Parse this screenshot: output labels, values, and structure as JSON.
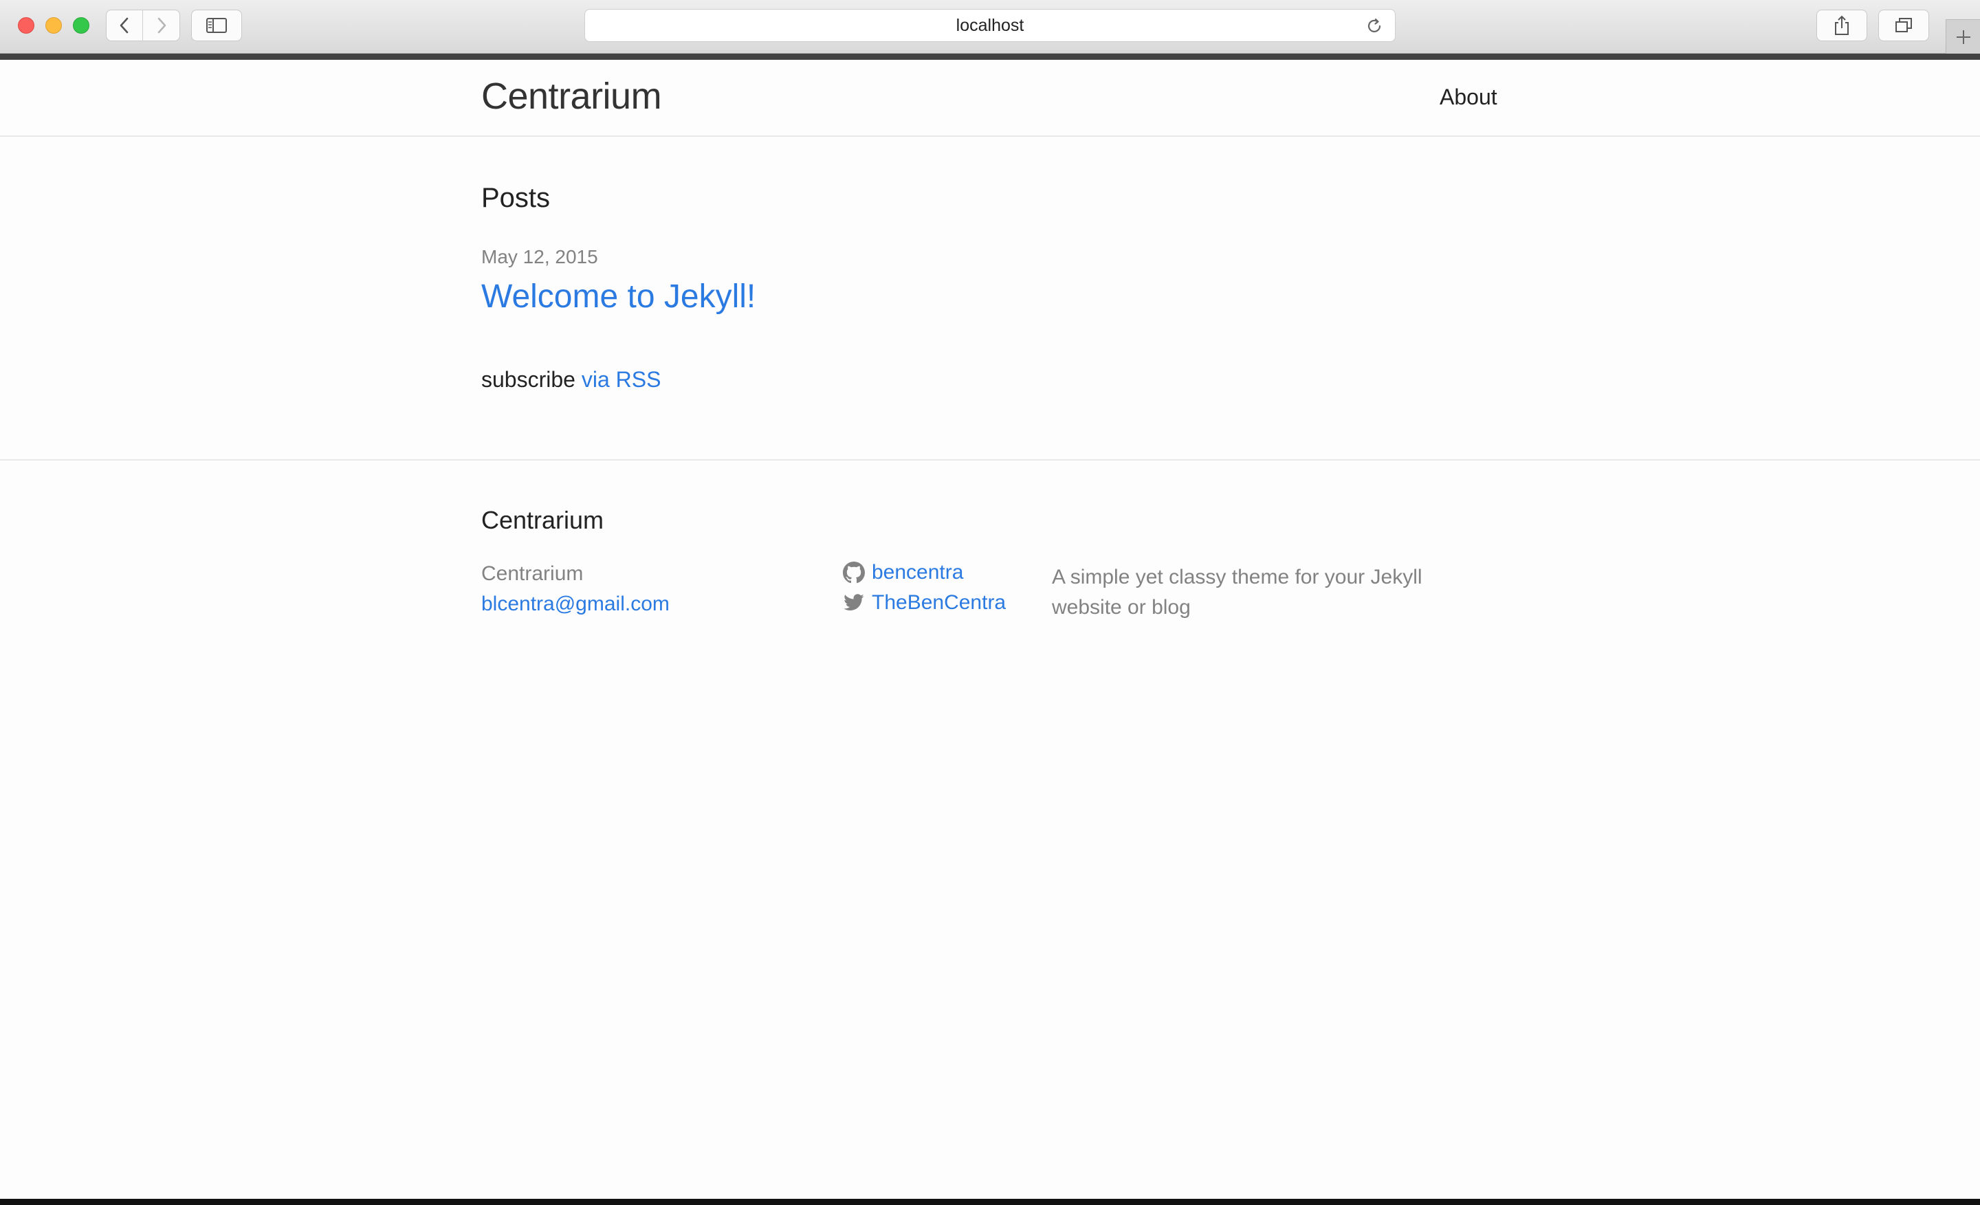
{
  "browser": {
    "url": "localhost"
  },
  "header": {
    "site_title": "Centrarium",
    "nav": [
      {
        "label": "About"
      }
    ]
  },
  "main": {
    "section_title": "Posts",
    "posts": [
      {
        "date": "May 12, 2015",
        "title": "Welcome to Jekyll!"
      }
    ],
    "rss": {
      "prefix": "subscribe",
      "link_label": "via RSS"
    }
  },
  "footer": {
    "heading": "Centrarium",
    "name": "Centrarium",
    "email": "blcentra@gmail.com",
    "github": {
      "icon": "github-icon",
      "username": "bencentra"
    },
    "twitter": {
      "icon": "twitter-icon",
      "username": "TheBenCentra"
    },
    "description": "A simple yet classy theme for your Jekyll website or blog"
  },
  "colors": {
    "link": "#2a7ae2",
    "text": "#222222",
    "muted": "#828282",
    "chrome_dark": "#424242"
  }
}
